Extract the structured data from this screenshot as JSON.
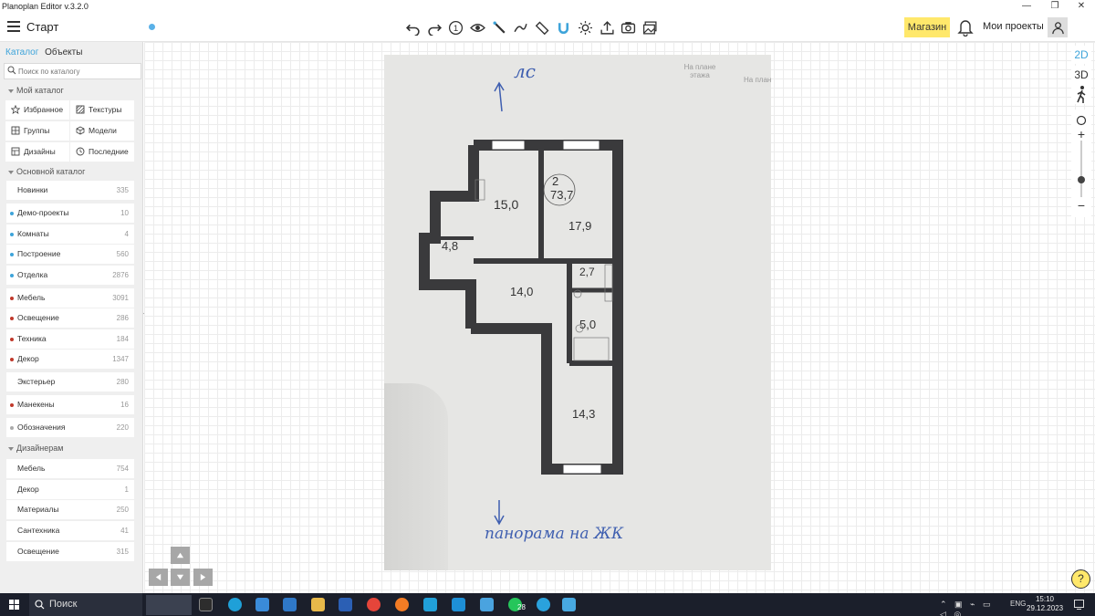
{
  "window": {
    "title": "Planoplan Editor v.3.2.0",
    "minimize_glyph": "—",
    "restore_glyph": "❐",
    "close_glyph": "✕"
  },
  "header": {
    "title": "Старт",
    "shop_label": "Магазин",
    "projects_label": "Мои проекты",
    "toolbar_icons": [
      "undo-icon",
      "redo-icon",
      "info-icon",
      "eye-icon",
      "wand-icon",
      "measure-icon",
      "ruler-icon",
      "magnet-icon",
      "sun-icon",
      "share-icon",
      "camera-icon",
      "gallery-icon"
    ],
    "info_glyph": "1"
  },
  "sidebar": {
    "tabs": [
      "Каталог",
      "Объекты"
    ],
    "search_placeholder": "Поиск по каталогу",
    "my_catalog": {
      "title": "Мой каталог",
      "items": [
        {
          "label": "Избранное",
          "icon": "star-icon"
        },
        {
          "label": "Текстуры",
          "icon": "texture-icon"
        },
        {
          "label": "Группы",
          "icon": "group-icon"
        },
        {
          "label": "Модели",
          "icon": "cube-icon"
        },
        {
          "label": "Дизайны",
          "icon": "layout-icon"
        },
        {
          "label": "Последние",
          "icon": "clock-icon"
        }
      ]
    },
    "main_catalog": {
      "title": "Основной каталог",
      "items": [
        {
          "label": "Новинки",
          "count": "335",
          "dot": ""
        },
        {
          "label": "Демо-проекты",
          "count": "10",
          "dot": "#3ea4da"
        },
        {
          "label": "Комнаты",
          "count": "4",
          "dot": "#3ea4da"
        },
        {
          "label": "Построение",
          "count": "560",
          "dot": "#3ea4da"
        },
        {
          "label": "Отделка",
          "count": "2876",
          "dot": "#3ea4da"
        },
        {
          "label": "Мебель",
          "count": "3091",
          "dot": "#c0392b"
        },
        {
          "label": "Освещение",
          "count": "286",
          "dot": "#c0392b"
        },
        {
          "label": "Техника",
          "count": "184",
          "dot": "#c0392b"
        },
        {
          "label": "Декор",
          "count": "1347",
          "dot": "#c0392b"
        },
        {
          "label": "Экстерьер",
          "count": "280",
          "dot": ""
        },
        {
          "label": "Манекены",
          "count": "16",
          "dot": "#c0392b"
        },
        {
          "label": "Обозначения",
          "count": "220",
          "dot": "#aaaaaa"
        }
      ]
    },
    "designers": {
      "title": "Дизайнерам",
      "items": [
        {
          "label": "Мебель",
          "count": "754"
        },
        {
          "label": "Декор",
          "count": "1"
        },
        {
          "label": "Материалы",
          "count": "250"
        },
        {
          "label": "Сантехника",
          "count": "41"
        },
        {
          "label": "Освещение",
          "count": "315"
        }
      ]
    }
  },
  "canvas": {
    "plan_captions": [
      "На плане этажа",
      "На плане компл"
    ],
    "handwriting_top": "лс",
    "handwriting_bottom": "панорама на ЖК",
    "rooms": [
      {
        "label": "15,0"
      },
      {
        "label": "2"
      },
      {
        "label": "73,7"
      },
      {
        "label": "17,9"
      },
      {
        "label": "4,8"
      },
      {
        "label": "14,0"
      },
      {
        "label": "2,7"
      },
      {
        "label": "5,0"
      },
      {
        "label": "14,3"
      }
    ]
  },
  "view_tools": {
    "mode_2d": "2D",
    "mode_3d": "3D",
    "zoom_in": "+",
    "zoom_out": "−",
    "zoom_level": 0.3
  },
  "help_label": "?",
  "taskbar": {
    "search_label": "Поиск",
    "badge_count": "28",
    "language": "ENG",
    "time": "15:10",
    "date": "29.12.2023"
  },
  "colors": {
    "accent": "#3ea4da",
    "shop": "#ffe86b",
    "wall": "#3a3a3c",
    "taskbar": "#1b1f2b"
  }
}
